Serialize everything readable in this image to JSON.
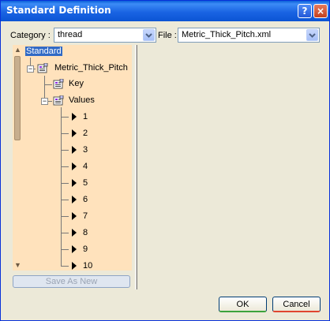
{
  "window": {
    "title": "Standard Definition",
    "help_label": "?",
    "close_label": "×"
  },
  "category": {
    "label": "Category :",
    "value": "thread"
  },
  "file": {
    "label": "File :",
    "value": "Metric_Thick_Pitch.xml"
  },
  "tree": {
    "root": "Standard",
    "child": "Metric_Thick_Pitch",
    "key": "Key",
    "values": "Values",
    "items": [
      "1",
      "2",
      "3",
      "4",
      "5",
      "6",
      "7",
      "8",
      "9",
      "10"
    ]
  },
  "buttons": {
    "save_as_new": "Save As New",
    "ok": "OK",
    "cancel": "Cancel"
  },
  "colors": {
    "tree_bg": "#ffe2bc",
    "title_bar": "#0a5fd8",
    "selection": "#316ac5"
  }
}
